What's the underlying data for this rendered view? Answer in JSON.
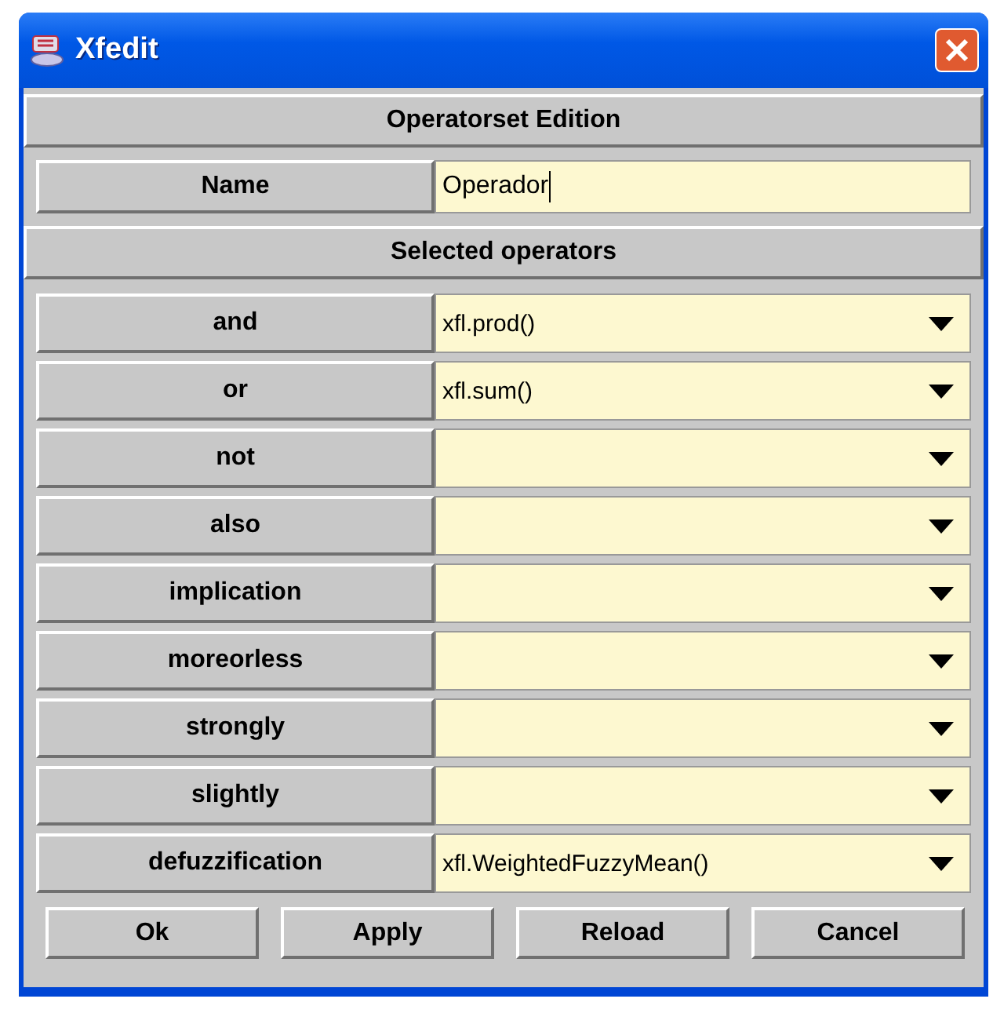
{
  "window": {
    "title": "Xfedit"
  },
  "header": "Operatorset Edition",
  "name_field": {
    "label": "Name",
    "value": "Operador"
  },
  "section": "Selected operators",
  "operators": [
    {
      "label": "and",
      "value": "xfl.prod()"
    },
    {
      "label": "or",
      "value": "xfl.sum()"
    },
    {
      "label": "not"
    },
    {
      "label": "also"
    },
    {
      "label": "implication"
    },
    {
      "label": "moreorless"
    },
    {
      "label": "strongly"
    },
    {
      "label": "slightly"
    },
    {
      "label": "defuzzification",
      "value": "xfl.WeightedFuzzyMean()"
    }
  ],
  "buttons": [
    "Ok",
    "Apply",
    "Reload",
    "Cancel"
  ]
}
